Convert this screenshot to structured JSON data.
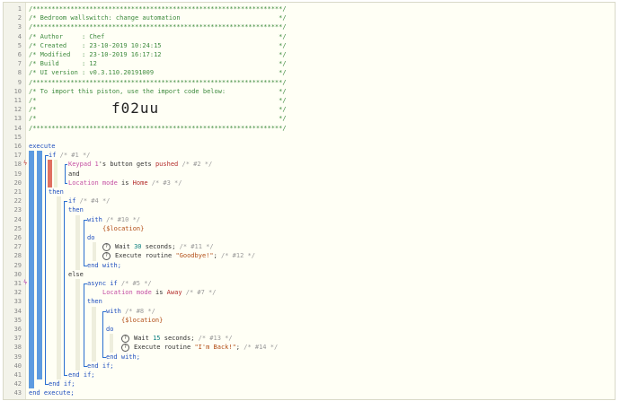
{
  "editor": {
    "import_code": "f02uu",
    "lines": [
      "/******************************************************************/",
      "/* Bedroom wallswitch: change automation                          */",
      "/******************************************************************/",
      "/* Author     : Chef                                              */",
      "/* Created    : 23-10-2019 10:24:15                               */",
      "/* Modified   : 23-10-2019 16:17:12                               */",
      "/* Build      : 12                                                */",
      "/* UI version : v0.3.110.20191009                                 */",
      "/******************************************************************/",
      "/* To import this piston, use the import code below:              */",
      "/*                                                                */",
      "/*                                                                */",
      "/*                                                                */",
      "/******************************************************************/",
      "",
      "execute",
      "if",
      "Keypad 1's button gets pushed",
      "and",
      "Location mode is Home",
      "then",
      "if",
      "then",
      "with",
      "{$location}",
      "do",
      "Wait 30 seconds;",
      "Execute routine \"Goodbye!\";",
      "end with;",
      "else",
      "async if",
      "Location mode is Away",
      "then",
      "with",
      "{$location}",
      "do",
      "Wait 15 seconds;",
      "Execute routine \"I'm Back!\";",
      "end with;",
      "end if;",
      "end if;",
      "end if;",
      "end execute;"
    ],
    "comments": {
      "c1": "/* #1 */",
      "c2": "/* #2 */",
      "c3": "/* #3 */",
      "c4": "/* #4 */",
      "c10": "/* #10 */",
      "c11": "/* #11 */",
      "c12": "/* #12 */",
      "c5": "/* #5 */",
      "c7": "/* #7 */",
      "c8": "/* #8 */",
      "c13": "/* #13 */",
      "c14": "/* #14 */"
    },
    "tokens": {
      "keypad": "Keypad 1",
      "apos_s": "'s",
      "button": " button",
      "gets": "gets",
      "pushed": "pushed",
      "location_mode": "Location mode",
      "is": "is",
      "home": "Home",
      "away": "Away",
      "wait": "Wait",
      "n30": "30",
      "n15": "15",
      "seconds": "seconds;",
      "execute_routine": "Execute routine",
      "goodbye": "\"Goodbye!\"",
      "back": "\"I'm Back!\"",
      "semicolon": ";"
    }
  }
}
